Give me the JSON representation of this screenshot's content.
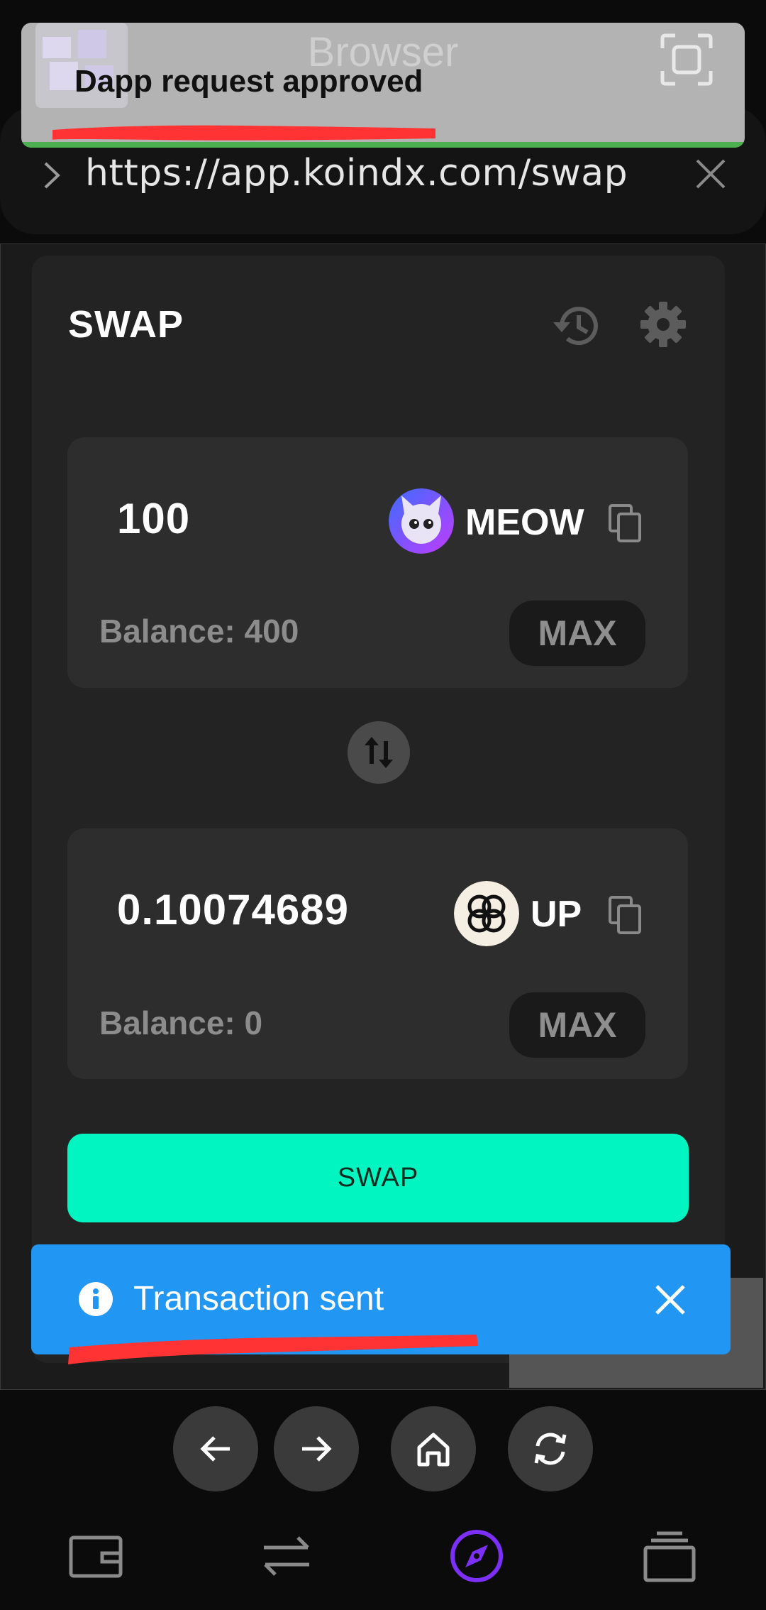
{
  "notification": {
    "app_name": "Browser",
    "title": "Dapp request approved",
    "progress_color": "#4caf50"
  },
  "browser": {
    "url": "https://app.koindx.com/swap"
  },
  "swap": {
    "title": "SWAP",
    "from": {
      "amount": "100",
      "token": "MEOW",
      "balance": "Balance: 400",
      "max_label": "MAX"
    },
    "to": {
      "amount": "0.10074689",
      "token": "UP",
      "balance": "Balance: 0",
      "max_label": "MAX"
    },
    "button_label": "SWAP",
    "accent": "#00f5c0"
  },
  "toast": {
    "message": "Transaction sent",
    "color": "#2196f3"
  },
  "nav_buttons": [
    "back-arrow-icon",
    "forward-arrow-icon",
    "home-icon",
    "refresh-icon"
  ],
  "bottom_tabs": [
    "wallet-icon",
    "swap-arrows-icon",
    "compass-icon",
    "stack-icon"
  ],
  "active_tab_color": "#7b2ff7"
}
